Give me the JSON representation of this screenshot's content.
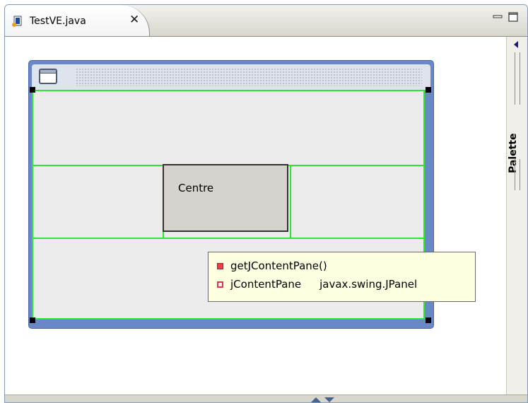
{
  "editor": {
    "tab": {
      "label": "TestVE.java",
      "close_glyph": "✕",
      "icon": "java-file-icon"
    },
    "window_controls": [
      "minimize-icon",
      "maximize-icon"
    ]
  },
  "palette": {
    "label": "Palette",
    "collapse_icon": "chevron-left-icon"
  },
  "frame": {
    "title_icon": "window-icon",
    "centre_button_label": "Centre"
  },
  "content_assist": {
    "items": [
      {
        "icon": "method-icon",
        "name": "getJContentPane()",
        "type": ""
      },
      {
        "icon": "field-icon",
        "name": "jContentPane",
        "type": "javax.swing.JPanel"
      }
    ]
  },
  "colors": {
    "frame_border": "#6a88c8",
    "layout_guides": "#2ee82e",
    "tooltip_bg": "#ffffe1"
  }
}
